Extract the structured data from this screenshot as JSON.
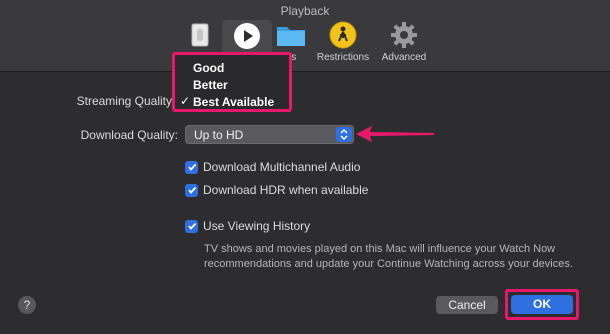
{
  "window": {
    "title": "Playback"
  },
  "toolbar": {
    "items": [
      {
        "label": "",
        "icon": "general-switch-icon"
      },
      {
        "label": "",
        "icon": "play-icon"
      },
      {
        "label": "es",
        "icon": "folder-icon"
      },
      {
        "label": "Restrictions",
        "icon": "restrictions-icon"
      },
      {
        "label": "Advanced",
        "icon": "gear-icon"
      }
    ]
  },
  "settings": {
    "streaming_label": "Streaming Quality",
    "download_label": "Download Quality:",
    "download_value": "Up to HD",
    "multichannel_label": "Download Multichannel Audio",
    "multichannel_checked": true,
    "hdr_label": "Download HDR when available",
    "hdr_checked": true,
    "history_label": "Use Viewing History",
    "history_checked": true,
    "history_note": "TV shows and movies played on this Mac will influence your Watch Now recommendations and update your Continue Watching across your devices."
  },
  "streaming_menu": {
    "options": [
      "Good",
      "Better",
      "Best Available"
    ],
    "selected": "Best Available",
    "check_glyph": "✓"
  },
  "footer": {
    "help": "?",
    "cancel": "Cancel",
    "ok": "OK"
  },
  "colors": {
    "accent": "#2f6fe0",
    "highlight": "#e8186a"
  }
}
